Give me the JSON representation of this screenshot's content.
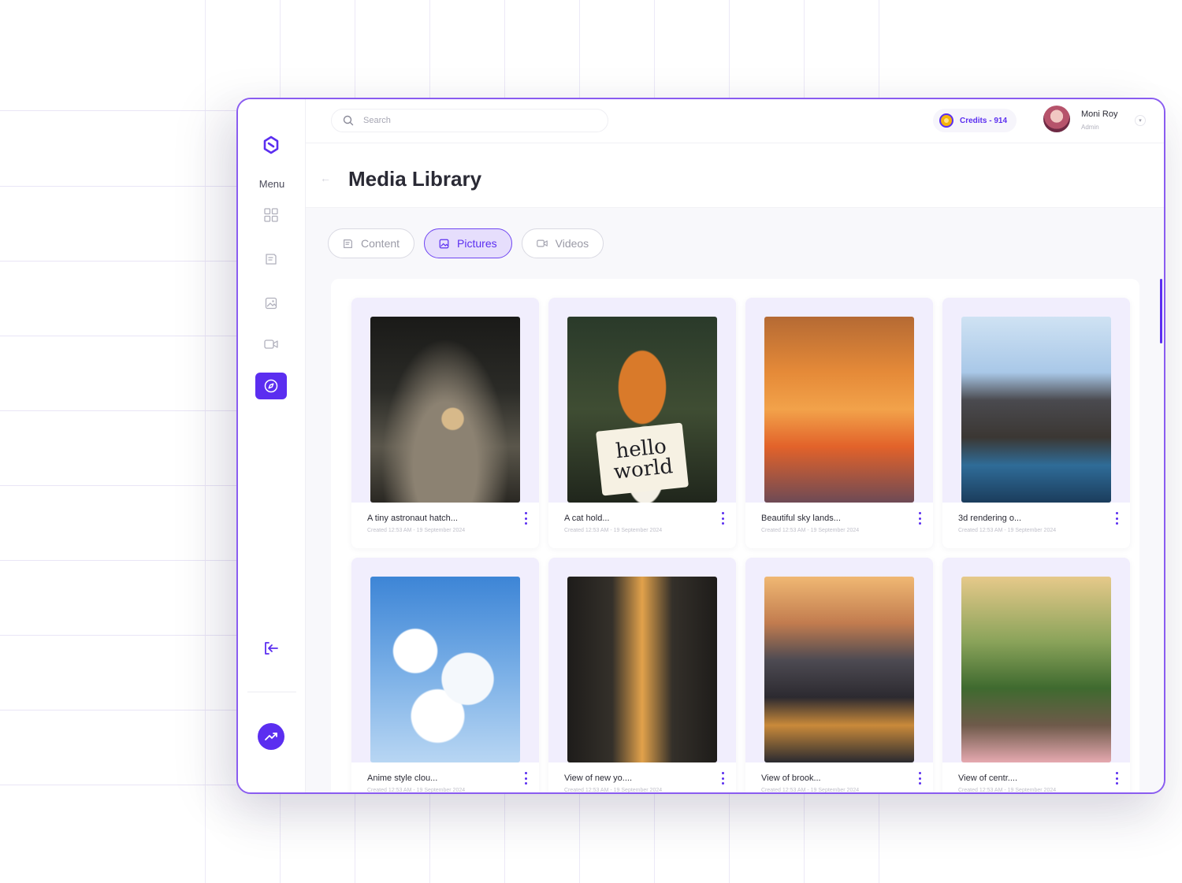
{
  "search": {
    "placeholder": "Search"
  },
  "credits": {
    "label": "Credits - 914"
  },
  "user": {
    "name": "Moni Roy",
    "role": "Admin"
  },
  "sidebar": {
    "menu_label": "Menu",
    "items": [
      {
        "name": "dashboard",
        "icon": "grid-icon"
      },
      {
        "name": "content",
        "icon": "document-icon"
      },
      {
        "name": "pictures",
        "icon": "image-icon"
      },
      {
        "name": "videos",
        "icon": "video-icon"
      },
      {
        "name": "media-library",
        "icon": "compass-icon",
        "active": true
      }
    ],
    "logout_icon": "logout-icon",
    "stats_icon": "trending-up-icon"
  },
  "page": {
    "title": "Media Library"
  },
  "tabs": [
    {
      "label": "Content",
      "icon": "document-icon",
      "active": false
    },
    {
      "label": "Pictures",
      "icon": "image-icon",
      "active": true
    },
    {
      "label": "Videos",
      "icon": "video-icon",
      "active": false
    }
  ],
  "cards": [
    {
      "title": "A tiny astronaut hatch...",
      "meta": "Created 12:53 AM - 19 September 2024"
    },
    {
      "title": "A cat hold...",
      "meta": "Created 12:53 AM - 19 September 2024",
      "sign": [
        "hello",
        "world"
      ]
    },
    {
      "title": "Beautiful sky lands...",
      "meta": "Created 12:53 AM - 19 September 2024"
    },
    {
      "title": "3d rendering o...",
      "meta": "Created 12:53 AM - 19 September 2024"
    },
    {
      "title": "Anime style clou...",
      "meta": "Created 12:53 AM - 19 September 2024"
    },
    {
      "title": "View of new yo....",
      "meta": "Created 12:53 AM - 19 September 2024"
    },
    {
      "title": "View of brook...",
      "meta": "Created 12:53 AM - 19 September 2024"
    },
    {
      "title": "View of centr....",
      "meta": "Created 12:53 AM - 19 September 2024"
    }
  ],
  "colors": {
    "accent": "#5b2ef0",
    "window_border": "#8a5cf0",
    "active_tab_bg": "#e6defc"
  }
}
